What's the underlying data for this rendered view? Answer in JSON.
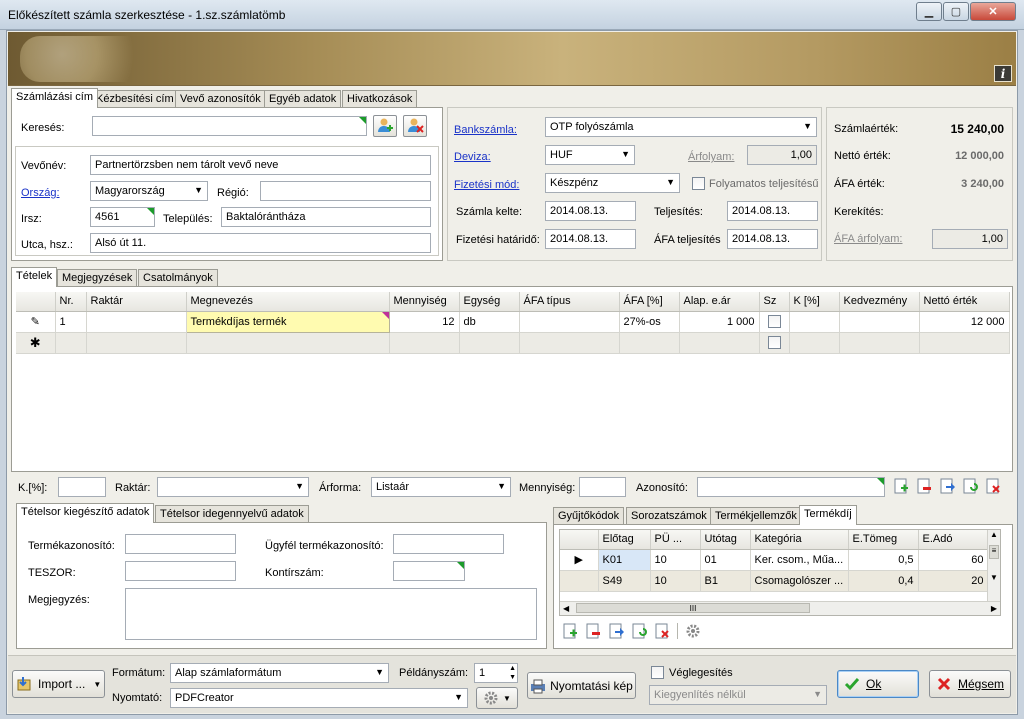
{
  "window": {
    "title": "Előkészített számla szerkesztése - 1.sz.számlatömb",
    "info_icon_label": "i"
  },
  "customer_tabs": [
    "Számlázási cím",
    "Kézbesítési cím",
    "Vevő azonosítók",
    "Egyéb adatok",
    "Hivatkozások"
  ],
  "customer": {
    "search_label": "Keresés:",
    "search_value": "",
    "name_label": "Vevőnév:",
    "name_value": "Partnertörzsben nem tárolt vevő neve",
    "country_label": "Ország:",
    "country_value": "Magyarország",
    "region_label": "Régió:",
    "region_value": "",
    "zip_label": "Irsz:",
    "zip_value": "4561",
    "city_label": "Település:",
    "city_value": "Baktalórántháza",
    "street_label": "Utca, hsz.:",
    "street_value": "Alsó út 11."
  },
  "payment": {
    "bank_label": "Bankszámla:",
    "bank_value": "OTP folyószámla",
    "currency_label": "Deviza:",
    "currency_value": "HUF",
    "rate_label": "Árfolyam:",
    "rate_value": "1,00",
    "method_label": "Fizetési mód:",
    "method_value": "Készpénz",
    "continuous_label": "Folyamatos teljesítésű",
    "issue_date_label": "Számla kelte:",
    "issue_date_value": "2014.08.13.",
    "fulfil_label": "Teljesítés:",
    "fulfil_value": "2014.08.13.",
    "due_label": "Fizetési határidő:",
    "due_value": "2014.08.13.",
    "vat_fulfil_label": "ÁFA teljesítés",
    "vat_fulfil_value": "2014.08.13."
  },
  "totals": {
    "invoice_label": "Számlaérték:",
    "invoice_value": "15 240,00",
    "net_label": "Nettó érték:",
    "net_value": "12 000,00",
    "vat_label": "ÁFA érték:",
    "vat_value": "3 240,00",
    "rounding_label": "Kerekítés:",
    "vat_rate_label": "ÁFA árfolyam:",
    "vat_rate_value": "1,00"
  },
  "items_tabs": [
    "Tételek",
    "Megjegyzések",
    "Csatolmányok"
  ],
  "items_grid": {
    "columns": [
      "Nr.",
      "Raktár",
      "Megnevezés",
      "Mennyiség",
      "Egység",
      "ÁFA típus",
      "ÁFA [%]",
      "Alap. e.ár",
      "Sz",
      "K [%]",
      "Kedvezmény",
      "Nettó érték"
    ],
    "rows": [
      {
        "nr": "1",
        "raktar": "",
        "megnevezes": "Termékdíjas termék",
        "mennyiseg": "12",
        "egyseg": "db",
        "afa_tipus": "",
        "afa": "27%-os",
        "ar": "1 000",
        "k": "",
        "kedvezmeny": "",
        "netto": "12 000"
      }
    ],
    "edit_icon": "pencil-icon",
    "new_row_icon": "asterisk-icon"
  },
  "filter_bar": {
    "k_label": "K.[%]:",
    "k_value": "",
    "warehouse_label": "Raktár:",
    "warehouse_value": "",
    "price_label": "Árforma:",
    "price_value": "Listaár",
    "qty_label": "Mennyiség:",
    "qty_value": "",
    "id_label": "Azonosító:",
    "id_value": ""
  },
  "detail_tabs": [
    "Tételsor kiegészítő adatok",
    "Tételsor idegennyelvű adatok"
  ],
  "detail": {
    "product_id_label": "Termékazonosító:",
    "client_product_id_label": "Ügyfél termékazonosító:",
    "teszor_label": "TESZOR:",
    "account_label": "Kontírszám:",
    "note_label": "Megjegyzés:"
  },
  "fee_tabs": [
    "Gyűjtőkódok",
    "Sorozatszámok",
    "Termékjellemzők",
    "Termékdíj"
  ],
  "fee_grid": {
    "columns": [
      "Előtag",
      "PÜ ...",
      "Utótag",
      "Kategória",
      "E.Tömeg",
      "E.Adó"
    ],
    "rows": [
      {
        "elotag": "K01",
        "pu": "10",
        "utotag": "01",
        "kategoria": "Ker. csom., Műa...",
        "tomeg": "0,5",
        "ado": "60"
      },
      {
        "elotag": "S49",
        "pu": "10",
        "utotag": "B1",
        "kategoria": "Csomagolószer ...",
        "tomeg": "0,4",
        "ado": "20"
      }
    ],
    "scroll_label": "III"
  },
  "footer": {
    "import_label": "Import ...",
    "format_label": "Formátum:",
    "format_value": "Alap számlaformátum",
    "printer_label": "Nyomtató:",
    "printer_value": "PDFCreator",
    "copies_label": "Példányszám:",
    "copies_value": "1",
    "preview_label": "Nyomtatási kép",
    "finalize_label": "Véglegesítés",
    "settlement_value": "Kiegyenlítés nélkül",
    "ok_label": "Ok",
    "cancel_label": "Mégsem"
  },
  "colors": {
    "link": "#1a33c8",
    "highlight_cell": "#fffbb0",
    "selected_row": "#d8e7f7",
    "fee_row_alt": "#ece9de"
  }
}
